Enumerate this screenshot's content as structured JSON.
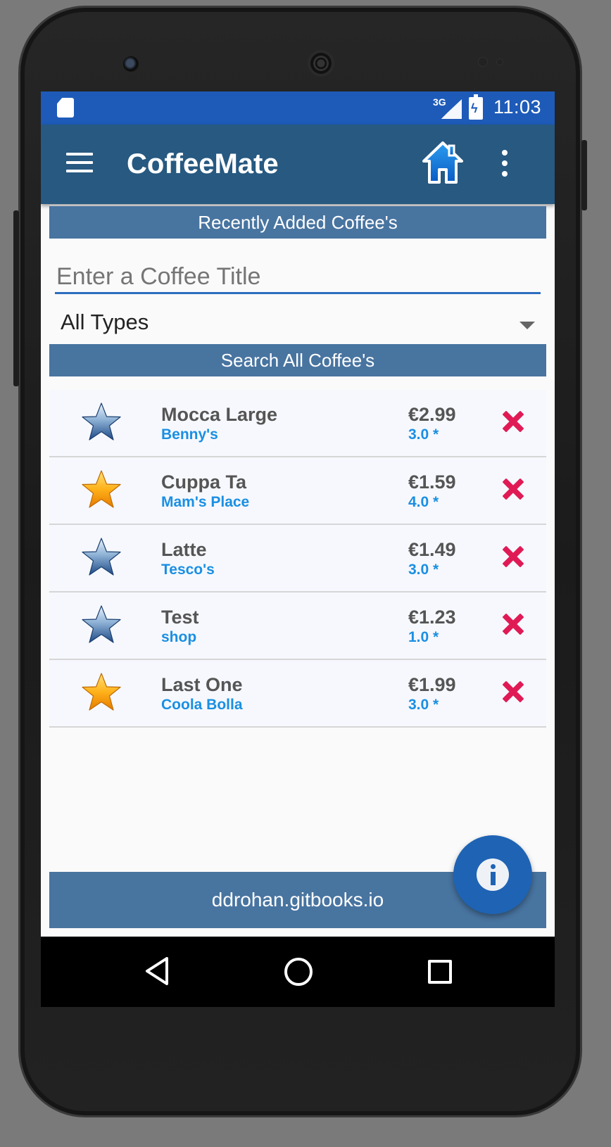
{
  "status_bar": {
    "network": "3G",
    "time": "11:03"
  },
  "app_bar": {
    "title": "CoffeeMate"
  },
  "recent_header": "Recently Added Coffee's",
  "search": {
    "placeholder": "Enter a Coffee Title",
    "value": ""
  },
  "type_filter": {
    "selected": "All Types"
  },
  "search_header": "Search All Coffee's",
  "coffees": [
    {
      "name": "Mocca Large",
      "shop": "Benny's",
      "price": "€2.99",
      "rating": "3.0 *",
      "favourite": false
    },
    {
      "name": "Cuppa Ta",
      "shop": "Mam's Place",
      "price": "€1.59",
      "rating": "4.0 *",
      "favourite": true
    },
    {
      "name": "Latte",
      "shop": "Tesco's",
      "price": "€1.49",
      "rating": "3.0 *",
      "favourite": false
    },
    {
      "name": "Test",
      "shop": "shop",
      "price": "€1.23",
      "rating": "1.0 *",
      "favourite": false
    },
    {
      "name": "Last One",
      "shop": "Coola Bolla",
      "price": "€1.99",
      "rating": "3.0 *",
      "favourite": true
    }
  ],
  "footer": {
    "text": "ddrohan.gitbooks.io"
  },
  "colors": {
    "status_bar": "#1e5bb8",
    "app_bar": "#275981",
    "section_bar": "#4874a0",
    "accent_blue": "#1a8fe3",
    "delete_red": "#e01a55",
    "fab": "#1f63b4"
  },
  "icons": {
    "menu": "hamburger-icon",
    "home": "home-icon",
    "more": "overflow-menu-icon",
    "favourite": "gold-star-icon",
    "not_favourite": "blue-star-icon",
    "delete": "delete-x-icon",
    "info": "info-icon"
  }
}
